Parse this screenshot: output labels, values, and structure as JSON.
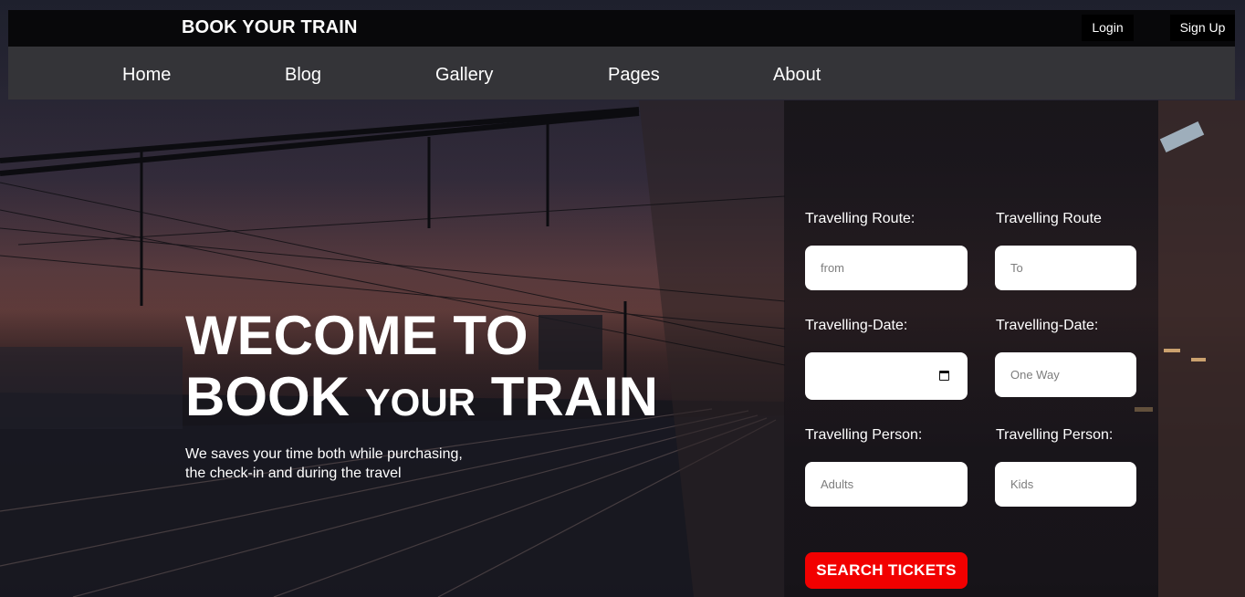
{
  "header": {
    "brand": "BOOK YOUR TRAIN",
    "login_label": "Login",
    "signup_label": "Sign Up"
  },
  "nav": {
    "items": [
      "Home",
      "Blog",
      "Gallery",
      "Pages",
      "About"
    ]
  },
  "hero": {
    "title_line1": "WECOME TO",
    "title_line2_a": "BOOK ",
    "title_line2_b": "YOUR",
    "title_line2_c": " TRAIN",
    "subtitle_line1": "We saves your time both while purchasing,",
    "subtitle_line2": "the check-in and during the travel"
  },
  "form": {
    "route_from_label": "Travelling Route:",
    "route_to_label": "Travelling Route",
    "from_placeholder": "from",
    "to_placeholder": "To",
    "date_label_1": "Travelling-Date:",
    "date_label_2": "Travelling-Date:",
    "oneway_placeholder": "One Way",
    "person_label_1": "Travelling Person:",
    "person_label_2": "Travelling Person:",
    "adults_placeholder": "Adults",
    "kids_placeholder": "Kids",
    "search_label": "SEARCH TICKETS"
  },
  "colors": {
    "accent_red": "#f20000",
    "topbar": "#060608",
    "nav": "#37373a"
  }
}
